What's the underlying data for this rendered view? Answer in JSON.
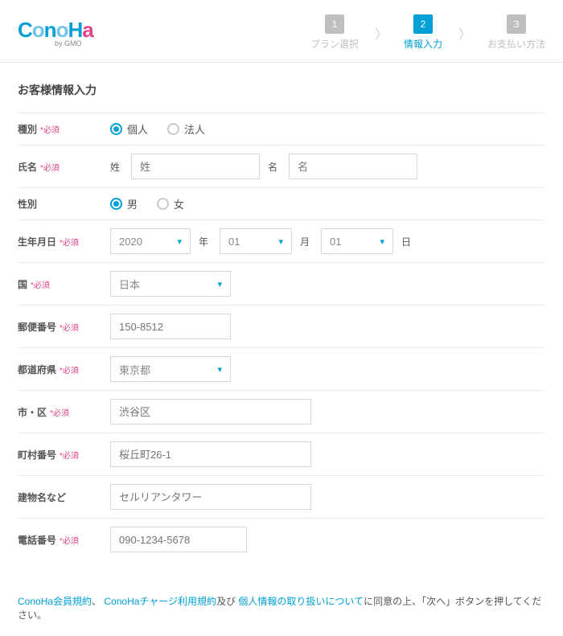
{
  "logo": {
    "text": "ConoHa",
    "sub": "by GMO"
  },
  "steps": [
    {
      "num": "1",
      "label": "プラン選択",
      "active": false
    },
    {
      "num": "2",
      "label": "情報入力",
      "active": true
    },
    {
      "num": "3",
      "label": "お支払い方法",
      "active": false
    }
  ],
  "sectionTitle": "お客様情報入力",
  "required": "*必須",
  "labels": {
    "type": "種別",
    "name": "氏名",
    "gender": "性別",
    "dob": "生年月日",
    "country": "国",
    "zip": "郵便番号",
    "pref": "都道府県",
    "city": "市・区",
    "addr": "町村番号",
    "bldg": "建物名など",
    "tel": "電話番号"
  },
  "type": {
    "personal": "個人",
    "corporate": "法人"
  },
  "name": {
    "sei": "姓",
    "mei": "名",
    "seiPh": "姓",
    "meiPh": "名"
  },
  "gender": {
    "male": "男",
    "female": "女"
  },
  "dob": {
    "year": "2020",
    "month": "01",
    "day": "01",
    "yu": "年",
    "mu": "月",
    "du": "日"
  },
  "country": "日本",
  "zip": {
    "ph": "150-8512"
  },
  "pref": "東京都",
  "city": {
    "ph": "渋谷区"
  },
  "addr": {
    "ph": "桜丘町26-1"
  },
  "bldg": {
    "ph": "セルリアンタワー"
  },
  "tel": {
    "ph": "090-1234-5678"
  },
  "note": {
    "l1": "ConoHa会員規約",
    "s1": "、",
    "l2": "ConoHaチャージ利用規約",
    "s2": "及び",
    "l3": "個人情報の取り扱いについて",
    "tail": "に同意の上、「次へ」ボタンを押してください。"
  }
}
